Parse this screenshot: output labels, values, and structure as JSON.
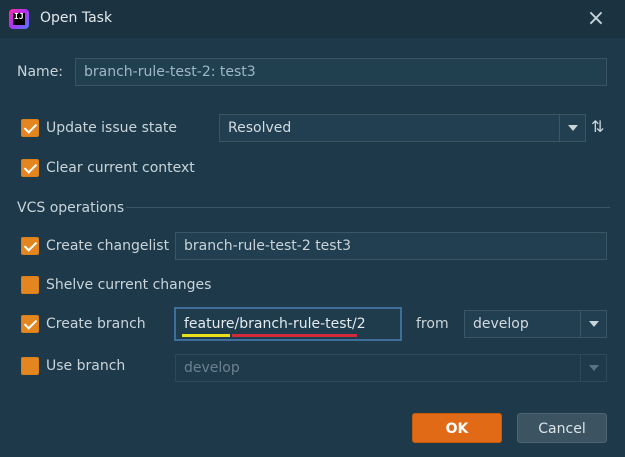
{
  "window": {
    "title": "Open Task",
    "icon": "jetbrains-ij-icon",
    "close_icon": "close-icon"
  },
  "name": {
    "label": "Name:",
    "value": "branch-rule-test-2: test3"
  },
  "update_issue_state": {
    "label": "Update issue state",
    "checked": true,
    "selected": "Resolved"
  },
  "sort_icon": "⇅",
  "clear_context": {
    "label": "Clear current context",
    "checked": true
  },
  "vcs": {
    "title": "VCS operations"
  },
  "create_changelist": {
    "label": "Create changelist",
    "checked": true,
    "value": "branch-rule-test-2 test3"
  },
  "shelve_changes": {
    "label": "Shelve current changes",
    "checked": false
  },
  "create_branch": {
    "label": "Create branch",
    "checked": true,
    "value": "feature/branch-rule-test/2",
    "from_label": "from",
    "from_selected": "develop"
  },
  "use_branch": {
    "label": "Use branch",
    "checked": false,
    "selected": "develop"
  },
  "buttons": {
    "ok": "OK",
    "cancel": "Cancel"
  },
  "colors": {
    "background": "#1e3a4a",
    "accent": "#e3861f",
    "ok_button": "#e06a16"
  }
}
